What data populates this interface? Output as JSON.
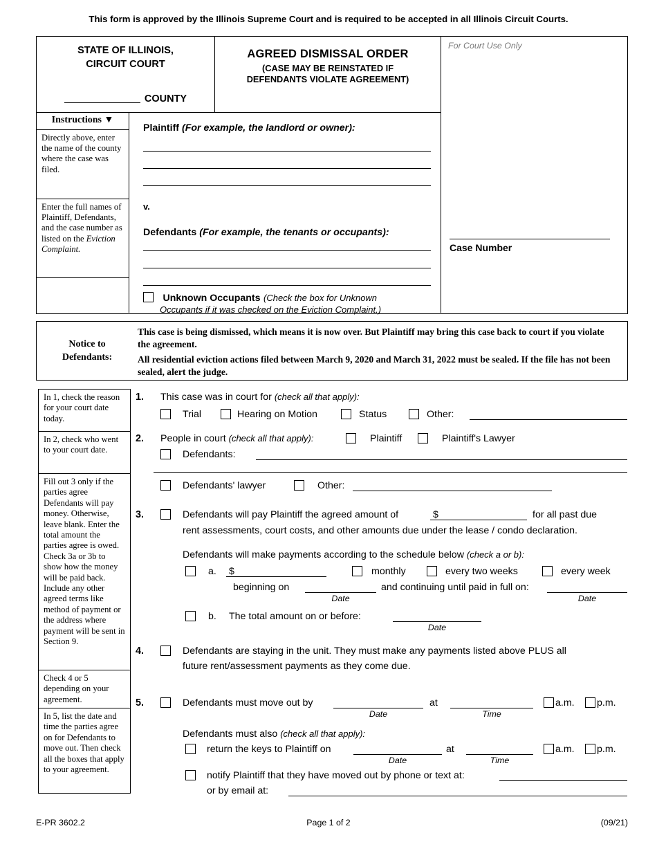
{
  "approval_notice": "This form is approved by the Illinois Supreme Court and is required to be accepted in all Illinois Circuit Courts.",
  "caption": {
    "state_line1": "STATE OF ILLINOIS,",
    "state_line2": "CIRCUIT COURT",
    "county_word": "COUNTY",
    "form_title": "AGREED DISMISSAL ORDER",
    "form_subtitle_line1": "(CASE MAY BE REINSTATED IF",
    "form_subtitle_line2": "DEFENDANTS VIOLATE AGREEMENT)",
    "court_use_only": "For Court Use Only",
    "case_number_label": "Case Number",
    "instructions_header": "Instructions",
    "instruction_1": "Directly above, enter the name of the county where the case was filed.",
    "instruction_2_a": "Enter the full names of Plaintiff, Defendants, and the case number as listed on the ",
    "instruction_2_b": "Eviction Complaint.",
    "plaintiff_label": "Plaintiff",
    "plaintiff_hint": "(For example, the landlord or owner):",
    "versus": "v.",
    "defendants_label": "Defendants",
    "defendants_hint": "(For example, the tenants or occupants):",
    "unknown_occupants_label": "Unknown Occupants",
    "unknown_occupants_hint_line1": "(Check the box for Unknown",
    "unknown_occupants_hint_line2": "Occupants if it was checked on the Eviction Complaint.)"
  },
  "notice": {
    "label_line1": "Notice to",
    "label_line2": "Defendants:",
    "paragraph_1": "This case is being dismissed, which means it is now over. But Plaintiff may bring this case back to court if you violate the agreement.",
    "paragraph_2": "All residential eviction actions filed between March 9, 2020 and March 31, 2022 must be sealed. If the file has not been sealed, alert the judge."
  },
  "side_instructions": {
    "item1": "In 1, check the reason for your court date today.",
    "item2": "In 2, check who went to your court date.",
    "item3": "Fill out 3 only if the parties agree Defendants will pay money. Otherwise, leave blank. Enter the total amount the parties agree is owed. Check 3a or 3b to show how the money will be paid back. Include any other agreed terms like method of payment or the address where payment will be sent in Section 9.",
    "item4": "Check 4 or 5 depending on your agreement.",
    "item5": "In 5, list the date and time the parties agree on for Defendants to move out. Then check all the boxes that apply to your agreement."
  },
  "sections": {
    "s1": {
      "number": "1.",
      "text": "This case was in court for",
      "hint": "(check all that apply):",
      "opt_trial": "Trial",
      "opt_hearing": "Hearing on Motion",
      "opt_status": "Status",
      "opt_other": "Other:"
    },
    "s2": {
      "number": "2.",
      "text": "People in court",
      "hint": "(check all that apply):",
      "opt_plaintiff": "Plaintiff",
      "opt_plaintiff_lawyer": "Plaintiff's Lawyer",
      "opt_defendants": "Defendants:",
      "opt_defendants_lawyer": "Defendants' lawyer",
      "opt_other": "Other:"
    },
    "s3": {
      "number": "3.",
      "line1_a": "Defendants will pay Plaintiff the agreed amount of",
      "dollar": "$",
      "line1_b": "for all past due",
      "line2": "rent assessments, court costs, and other amounts due under the lease / condo declaration.",
      "schedule_text": "Defendants will make payments according to the schedule below",
      "schedule_hint": "(check a or b):",
      "a_label": "a.",
      "a_dollar": "$",
      "opt_monthly": "monthly",
      "opt_biweekly": "every two weeks",
      "opt_weekly": "every week",
      "beginning_on": "beginning on",
      "continuing": "and continuing until paid in full on:",
      "b_label": "b.",
      "b_text": "The total amount on or before:",
      "date_label": "Date"
    },
    "s4": {
      "number": "4.",
      "line1": "Defendants are staying in the unit. They must make any payments listed above PLUS all",
      "line2": "future rent/assessment payments as they come due."
    },
    "s5": {
      "number": "5.",
      "line1": "Defendants must move out by",
      "at": "at",
      "am": "a.m.",
      "pm": "p.m.",
      "date_label": "Date",
      "time_label": "Time",
      "also_text": "Defendants must also",
      "also_hint": "(check all that apply):",
      "keys_text": "return the keys to Plaintiff on",
      "notify_text": "notify Plaintiff that they have moved out by phone or text at:",
      "email_text": "or by email at:"
    }
  },
  "footer": {
    "form_code": "E-PR 3602.2",
    "page": "Page 1 of 2",
    "revision": "(09/21)"
  }
}
